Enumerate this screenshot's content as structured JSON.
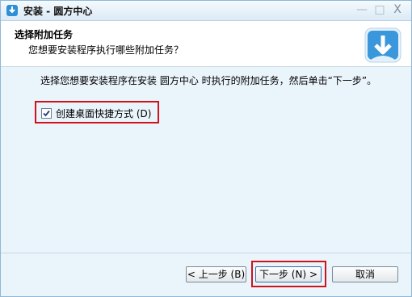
{
  "window": {
    "title": "安装 - 圆方中心",
    "controls": {
      "minimize": "—",
      "maximize": "□",
      "close": "X"
    }
  },
  "header": {
    "title": "选择附加任务",
    "subtitle": "您想要安装程序执行哪些附加任务？",
    "logo_icon": "download-arrow-icon"
  },
  "content": {
    "description": "选择您想要安装程序在安装 圆方中心 时执行的附加任务，然后单击“下一步”。",
    "tasks": [
      {
        "label": "创建桌面快捷方式 (D)",
        "checked": true
      }
    ]
  },
  "buttons": {
    "back": "< 上一步 (B)",
    "next": "下一步 (N) >",
    "cancel": "取消"
  },
  "colors": {
    "highlight": "#d0121b",
    "accent": "#2f8fd6"
  }
}
